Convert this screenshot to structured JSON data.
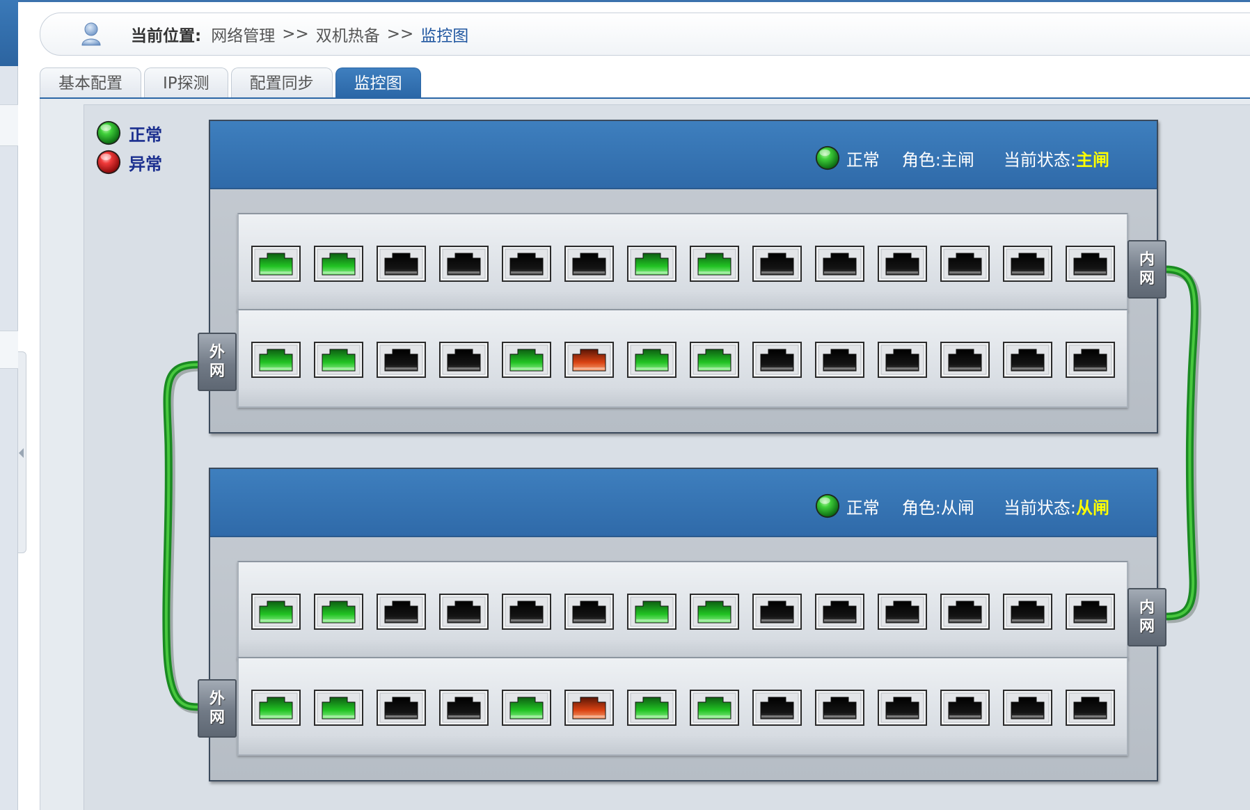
{
  "breadcrumb": {
    "label": "当前位置:",
    "items": [
      "网络管理",
      "双机热备",
      "监控图"
    ],
    "separator": ">>"
  },
  "tabs": [
    {
      "label": "基本配置",
      "active": false
    },
    {
      "label": "IP探测",
      "active": false
    },
    {
      "label": "配置同步",
      "active": false
    },
    {
      "label": "监控图",
      "active": true
    }
  ],
  "legend": [
    {
      "label": "正常",
      "color": "green"
    },
    {
      "label": "异常",
      "color": "red"
    }
  ],
  "devices": [
    {
      "status": "正常",
      "role": "角色:主闸",
      "state_label": "当前状态:",
      "state_value": "主闸",
      "inner_label": [
        "内",
        "网"
      ],
      "outer_label": [
        "外",
        "网"
      ],
      "top_ports": [
        "green",
        "green",
        "off",
        "off",
        "off",
        "off",
        "green",
        "green",
        "off",
        "off",
        "off",
        "off",
        "off",
        "off"
      ],
      "bottom_ports": [
        "green",
        "green",
        "off",
        "off",
        "green",
        "red",
        "green",
        "green",
        "off",
        "off",
        "off",
        "off",
        "off",
        "off"
      ]
    },
    {
      "status": "正常",
      "role": "角色:从闸",
      "state_label": "当前状态:",
      "state_value": "从闸",
      "inner_label": [
        "内",
        "网"
      ],
      "outer_label": [
        "外",
        "网"
      ],
      "top_ports": [
        "green",
        "green",
        "off",
        "off",
        "off",
        "off",
        "green",
        "green",
        "off",
        "off",
        "off",
        "off",
        "off",
        "off"
      ],
      "bottom_ports": [
        "green",
        "green",
        "off",
        "off",
        "green",
        "red",
        "green",
        "green",
        "off",
        "off",
        "off",
        "off",
        "off",
        "off"
      ]
    }
  ],
  "colors": {
    "accent": "#2f6aa9",
    "ok": "#22b022",
    "error": "#d63a10",
    "highlight": "#ffff00",
    "cable": "#22a02a"
  }
}
